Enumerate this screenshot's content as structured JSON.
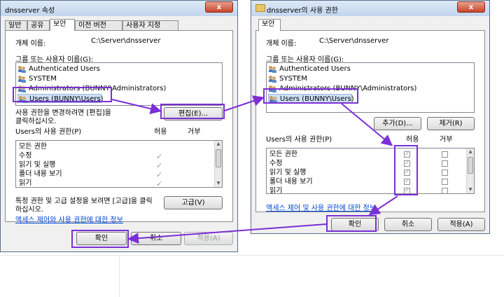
{
  "left_dialog": {
    "title": "dnsserver 속성",
    "close": "x",
    "tabs": [
      "일반",
      "공유",
      "보안",
      "이전 버전",
      "사용자 지정"
    ],
    "object_label": "개체 이름:",
    "object_value": "C:\\Server\\dnsserver",
    "group_label": "그룹 또는 사용자 이름(G):",
    "users": [
      "Authenticated Users",
      "SYSTEM",
      "Administrators (BUNNY\\Administrators)",
      "Users (BUNNY\\Users)"
    ],
    "change_text": [
      "사용 권한을 변경하려면 [편집]을",
      "클릭하십시오."
    ],
    "edit_button": "편집(E)...",
    "perm_label": "Users의 사용 권한(P)",
    "allow_header": "허용",
    "deny_header": "거부",
    "permissions": [
      "모든 권한",
      "수정",
      "읽기 및 실행",
      "폴더 내용 보기",
      "읽기"
    ],
    "advanced_text": [
      "특정 권한 및 고급 설정을 보려면 [고급]을 클릭",
      "하십시오."
    ],
    "advanced_button": "고급(V)",
    "link_text": "액세스 제어와 사용 권한에 대한 정보",
    "ok_button": "확인",
    "cancel_button": "취소",
    "apply_button": "적용(A)"
  },
  "right_dialog": {
    "title": "dnsserver의 사용 권한",
    "close": "x",
    "tab": "보안",
    "object_label": "개체 이름:",
    "object_value": "C:\\Server\\dnsserver",
    "group_label": "그룹 또는 사용자 이름(G):",
    "users": [
      "Authenticated Users",
      "SYSTEM",
      "Administrators (BUNNY\\Administrators)",
      "Users (BUNNY\\Users)"
    ],
    "add_button": "추가(D)...",
    "remove_button": "제거(R)",
    "perm_label": "Users의 사용 권한(P)",
    "allow_header": "허용",
    "deny_header": "거부",
    "permissions": [
      "모든 권한",
      "수정",
      "읽기 및 실행",
      "폴더 내용 보기",
      "읽기"
    ],
    "link_text": "액세스 제어 및 사용 권한에 대한 정보",
    "ok_button": "확인",
    "cancel_button": "취소",
    "apply_button": "적용(A)"
  },
  "colors": {
    "highlight": "#7b2fd6",
    "link": "#0046d5",
    "title_gradient_top": "#dde8f5"
  }
}
